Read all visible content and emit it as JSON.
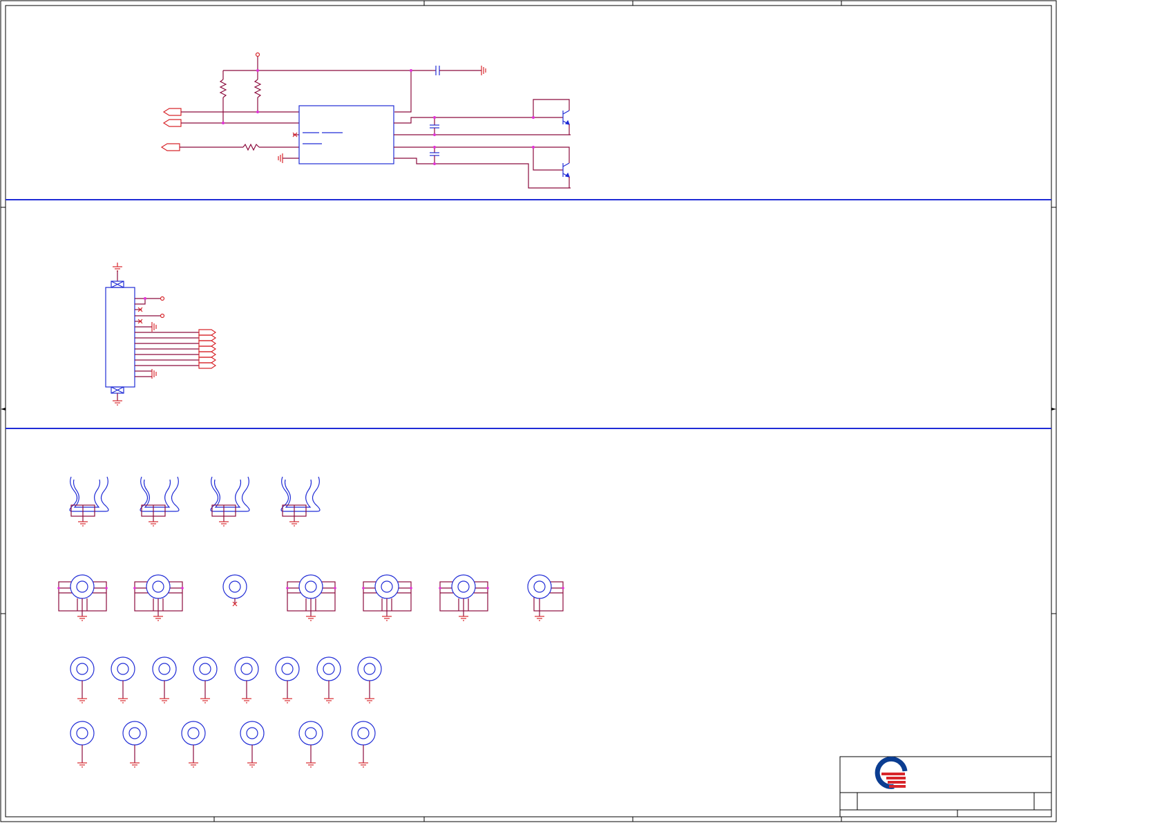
{
  "sheet": {
    "background": "#ffffff",
    "colors": {
      "border": "#000000",
      "wire": "#8b0a3c",
      "symbol": "#1f2bd6",
      "pin": "#d8262b",
      "junction": "#e032d6",
      "section_divider": "#1f2bd6"
    }
  },
  "title_block": {
    "logo_name": "company-logo",
    "logo_colors": [
      "#0b3d91",
      "#d8262b"
    ]
  },
  "sections": [
    {
      "id": "transistor-driver-section",
      "contents": [
        "ic-block",
        "resistor",
        "capacitor",
        "npn-transistor",
        "ground-symbol",
        "offpage-connector"
      ]
    },
    {
      "id": "connector-section",
      "contents": [
        "connector-header",
        "offpage-connector",
        "ground-symbol"
      ]
    },
    {
      "id": "mounting-hardware-section",
      "contents": [
        "standoff",
        "mounting-hole",
        "ground-symbol"
      ]
    }
  ]
}
